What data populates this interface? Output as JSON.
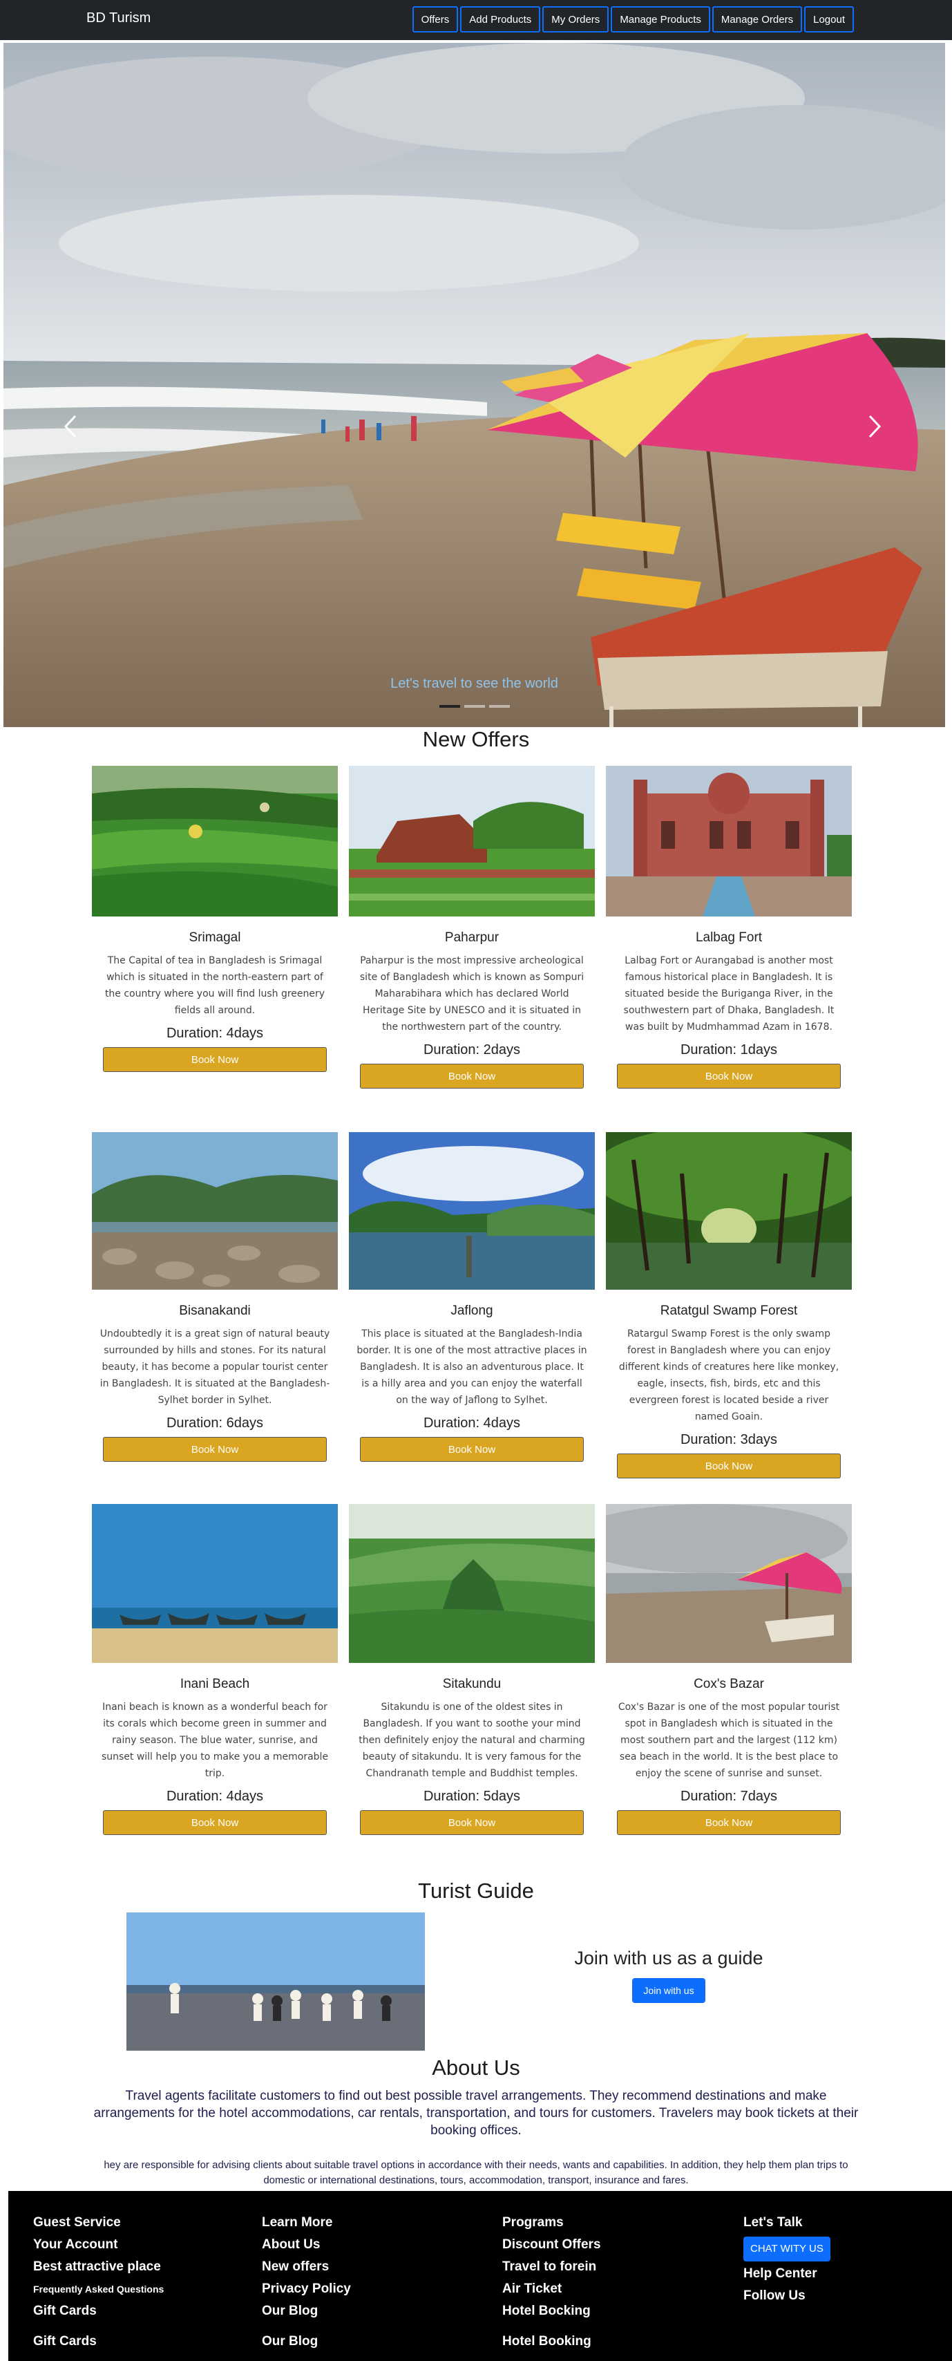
{
  "navbar": {
    "brand": "BD Turism",
    "links": [
      "Offers",
      "Add Products",
      "My Orders",
      "Manage Products",
      "Manage Orders",
      "Logout"
    ]
  },
  "carousel": {
    "caption": "Let's travel to see the world",
    "slides_count": 3,
    "active_slide": 1
  },
  "offers": {
    "title": "New Offers",
    "button_label": "Book Now",
    "items": [
      {
        "name": "Srimagal",
        "description": "The Capital of tea in Bangladesh is Srimagal which is situated in the north-eastern part of the country where you will find lush greenery fields all around.",
        "duration": "Duration: 4days"
      },
      {
        "name": "Paharpur",
        "description": "Paharpur is the most impressive archeological site of Bangladesh which is known as Sompuri Maharabihara which has declared World Heritage Site by UNESCO and it is situated in the northwestern part of the country.",
        "duration": "Duration: 2days"
      },
      {
        "name": "Lalbag Fort",
        "description": "Lalbag Fort or Aurangabad is another most famous historical place in Bangladesh. It is situated beside the Buriganga River, in the southwestern part of Dhaka, Bangladesh. It was built by Mudmhammad Azam in 1678.",
        "duration": "Duration: 1days"
      },
      {
        "name": "Bisanakandi",
        "description": "Undoubtedly it is a great sign of natural beauty surrounded by hills and stones. For its natural beauty, it has become a popular tourist center in Bangladesh. It is situated at the Bangladesh-Sylhet border in Sylhet.",
        "duration": "Duration: 6days"
      },
      {
        "name": "Jaflong",
        "description": "This place is situated at the Bangladesh-India border. It is one of the most attractive places in Bangladesh. It is also an adventurous place. It is a hilly area and you can enjoy the waterfall on the way of Jaflong to Sylhet.",
        "duration": "Duration: 4days"
      },
      {
        "name": "Ratatgul Swamp Forest",
        "description": "Ratargul Swamp Forest is the only swamp forest in Bangladesh where you can enjoy different kinds of creatures here like monkey, eagle, insects, fish, birds, etc and this evergreen forest is located beside a river named Goain.",
        "duration": "Duration: 3days"
      },
      {
        "name": "Inani Beach",
        "description": "Inani beach is known as a wonderful beach for its corals which become green in summer and rainy season. The blue water, sunrise, and sunset will help you to make you a memorable trip.",
        "duration": "Duration: 4days"
      },
      {
        "name": "Sitakundu",
        "description": "Sitakundu is one of the oldest sites in Bangladesh. If you want to soothe your mind then definitely enjoy the natural and charming beauty of sitakundu. It is very famous for the Chandranath temple and Buddhist temples.",
        "duration": "Duration: 5days"
      },
      {
        "name": "Cox's Bazar",
        "description": "Cox's Bazar is one of the most popular tourist spot in Bangladesh which is situated in the most southern part and the largest (112 km) sea beach in the world. It is the best place to enjoy the scene of sunrise and sunset.",
        "duration": "Duration: 7days"
      }
    ]
  },
  "guide": {
    "title": "Turist Guide",
    "join_title": "Join with us as a guide",
    "join_button": "Join with us"
  },
  "about": {
    "title": "About Us",
    "paragraph1": "Travel agents facilitate customers to find out best possible travel arrangements. They recommend destinations and make arrangements for the hotel accommodations, car rentals, transportation, and tours for customers. Travelers may book tickets at their booking offices.",
    "paragraph2": "hey are responsible for advising clients about suitable travel options in accordance with their needs, wants and capabilities. In addition, they help them plan trips to domestic or international destinations, tours, accommodation, transport, insurance and fares."
  },
  "footer": {
    "col1": [
      "Guest Service",
      "Your Account",
      "Best attractive place",
      "Frequently Asked Questions",
      "Gift Cards",
      "Gift Cards"
    ],
    "col2": [
      "Learn More",
      "About Us",
      "New offers",
      "Privacy Policy",
      "Our Blog",
      "Our Blog"
    ],
    "col3": [
      "Programs",
      "Discount Offers",
      "Travel to forein",
      "Air Ticket",
      "Hotel Bocking",
      "Hotel Booking"
    ],
    "col4": {
      "title": "Let's Talk",
      "chat_button": "CHAT WITY US",
      "links": [
        "Help Center",
        "Follow Us"
      ]
    }
  },
  "colors": {
    "navbar_bg": "#212529",
    "accent_blue": "#0d6efd",
    "book_button": "#daa520",
    "footer_bg": "#000000"
  }
}
